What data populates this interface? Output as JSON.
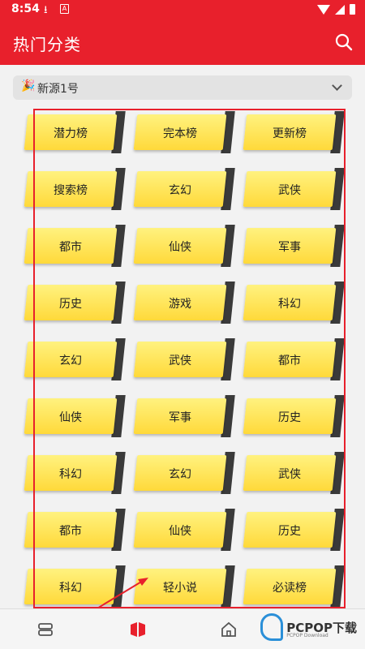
{
  "status_bar": {
    "time": "8:54",
    "icon_download": "download-icon",
    "icon_app": "A"
  },
  "app_bar": {
    "title": "热门分类",
    "search_icon": "search-icon"
  },
  "source_selector": {
    "label": "新源1号",
    "icon": "party-popper-icon"
  },
  "categories": [
    "潜力榜",
    "完本榜",
    "更新榜",
    "搜索榜",
    "玄幻",
    "武侠",
    "都市",
    "仙侠",
    "军事",
    "历史",
    "游戏",
    "科幻",
    "玄幻",
    "武侠",
    "都市",
    "仙侠",
    "军事",
    "历史",
    "科幻",
    "玄幻",
    "武侠",
    "都市",
    "仙侠",
    "历史",
    "科幻",
    "轻小说",
    "必读榜"
  ],
  "bottom_nav": {
    "items": [
      "bookshelf-icon",
      "category-icon",
      "home-icon"
    ]
  },
  "watermark": {
    "brand": "PCPOP",
    "suffix": "下载",
    "sub": "PCPOP Download"
  },
  "colors": {
    "accent": "#e8202c",
    "tile": "#ffe45a"
  }
}
